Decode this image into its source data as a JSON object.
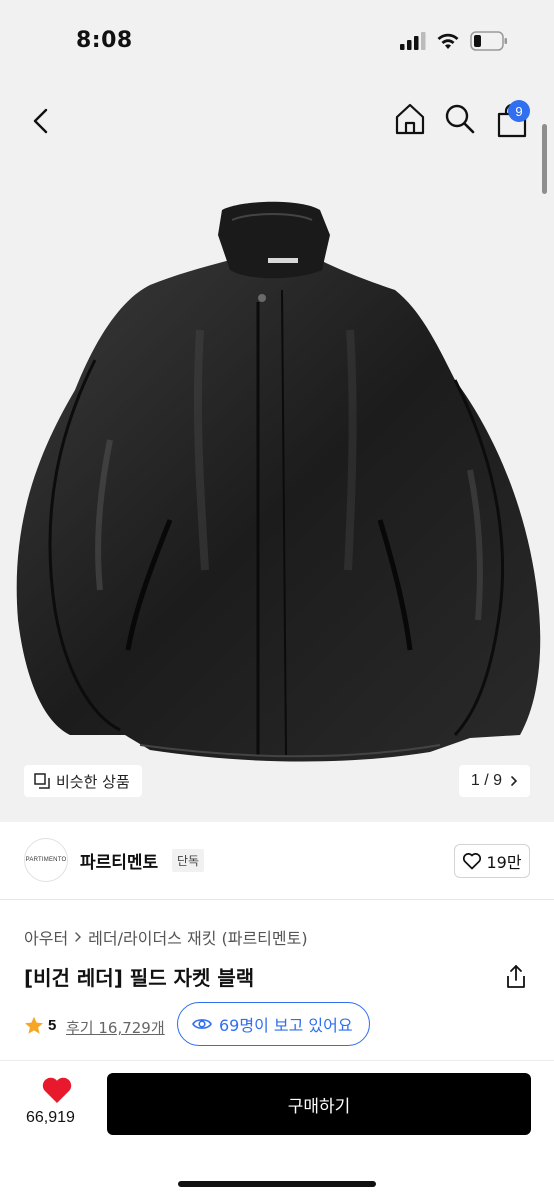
{
  "status_bar": {
    "time": "8:08"
  },
  "nav": {
    "cart_count": "9"
  },
  "gallery": {
    "similar_label": "비슷한 상품",
    "pager": "1 / 9"
  },
  "brand": {
    "logo_text": "PARTIMENTO",
    "name": "파르티멘토",
    "tag": "단독",
    "likes": "19만"
  },
  "breadcrumb": {
    "category": "아우터",
    "subcategory": "레더/라이더스 재킷 (파르티멘토)"
  },
  "product": {
    "title": "[비건 레더] 필드 자켓 블랙",
    "rating": "5",
    "reviews": "후기 16,729개",
    "viewers": "69명이 보고 있어요"
  },
  "bottom": {
    "wish_count": "66,919",
    "buy_label": "구매하기"
  },
  "colors": {
    "accent": "#2f6ff0",
    "heart": "#e8192c",
    "star": "#f5a623"
  }
}
